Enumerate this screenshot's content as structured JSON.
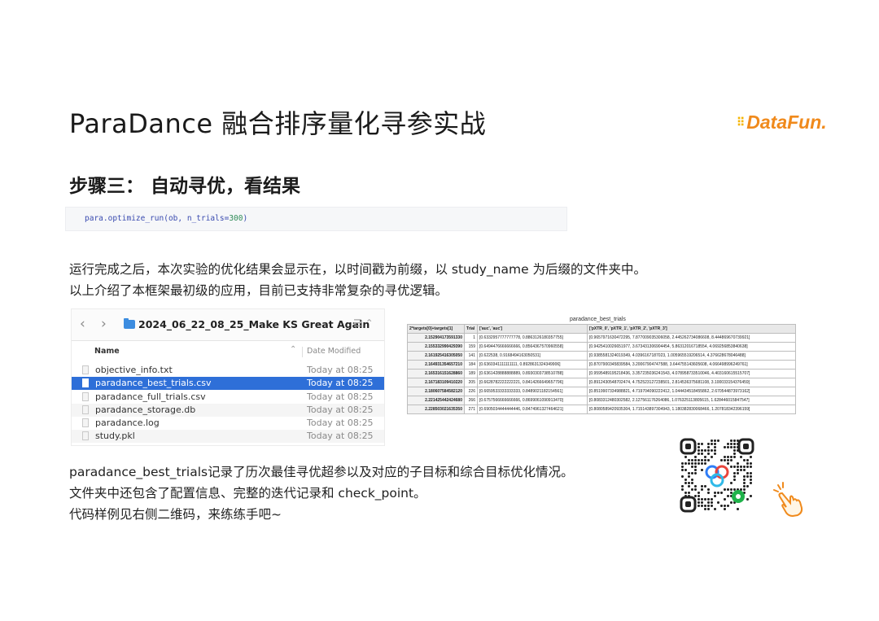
{
  "slide": {
    "title": "ParaDance 融合排序量化寻参实战",
    "step_heading": "步骤三： 自动寻优，看结果"
  },
  "logo": {
    "text_data": "Data",
    "text_fun": "Fun",
    "text_dot": ".",
    "color": "#f08a1c"
  },
  "code": {
    "prefix": "para.optimize_run(ob, n_trials=",
    "number": "300",
    "suffix": ")"
  },
  "intro": [
    "运行完成之后，本次实验的优化结果会显示在，以时间戳为前缀，以 study_name 为后缀的文件夹中。",
    "以上介绍了本框架最初级的应用，目前已支持非常复杂的寻优逻辑。"
  ],
  "finder": {
    "back": "‹",
    "forward": "›",
    "folder_name": "2024_06_22_08_25_Make KS Great Again",
    "view_toggle": "☰ ⌃",
    "col_name": "Name",
    "sort_chevron": "⌃",
    "col_date": "Date Modified",
    "files": [
      {
        "name": "objective_info.txt",
        "date": "Today at 08:25"
      },
      {
        "name": "paradance_best_trials.csv",
        "date": "Today at 08:25",
        "selected": true
      },
      {
        "name": "paradance_full_trials.csv",
        "date": "Today at 08:25"
      },
      {
        "name": "paradance_storage.db",
        "date": "Today at 08:25"
      },
      {
        "name": "paradance.log",
        "date": "Today at 08:25"
      },
      {
        "name": "study.pkl",
        "date": "Today at 08:25"
      }
    ],
    "selected_color": "#2e6fd8"
  },
  "csv": {
    "title": "paradance_best_trials",
    "headers": [
      "2*targets[0]+targets[1]",
      "Trial",
      "['auc', 'auc']",
      "['pXTR_0', 'pXTR_1', 'pXTR_2', 'pXTR_3']"
    ],
    "rows": [
      [
        "2.152904173591330",
        "1",
        "[0.6332957777777778, 0.8863126180357755]",
        "[0.9657971630472295, 7.877009035306058, 2.445262734086608, 8.444869670739921]"
      ],
      [
        "2.155332990429390",
        "159",
        "[0.6494476666666666, 0.8564367570960558]",
        "[0.9425410026651977, 3.673431306904454, 5.86312016718554, 4.069256853840638]"
      ],
      [
        "2.161925416305050",
        "141",
        "[0.622538, 0.9168494163050531]",
        "[0.9385581324019349, 4.0396167187023, 1.005965519206514, 4.376628678046488]"
      ],
      [
        "2.164931354657210",
        "184",
        "[0.6360341111111111, 0.8928631324349906]",
        "[0.8707900345839584, 3.20067904747588, 3.644755143605608, 4.066498996249761]"
      ],
      [
        "2.165316151628860",
        "189",
        "[0.6361428888888889, 0.8930303738510788]",
        "[0.9595489195218436, 3.357235036241543, 4.078958733510046, 4.403160615515707]"
      ],
      [
        "2.167183109410220",
        "205",
        "[0.6628782222222221, 0.8414266649657796]",
        "[0.8912430548702474, 4.752523127238501, 2.814536375681108, 3.100033154376459]"
      ],
      [
        "2.180607584582120",
        "226",
        "[0.6659533333333333, 0.8489021182154561]",
        "[0.8519907334988821, 4.719704090222412, 1.044434518455862, 2.670544873973162]"
      ],
      [
        "2.221425442424680",
        "266",
        "[0.6757566666666666, 0.8699061090913470]",
        "[0.8083312480302582, 2.127561176264086, 1.076325113805615, 1.628446015847547]"
      ],
      [
        "2.228503021635350",
        "271",
        "[0.6905034444444446, 0.8474961327464621]",
        "[0.8080589420935304, 1.715143897304943, 1.180382830068466, 1.207818342396159]"
      ]
    ]
  },
  "summary": [
    "paradance_best_trials记录了历次最佳寻优超参以及对应的子目标和综合目标优化情况。",
    "文件夹中还包含了配置信息、完整的迭代记录和 check_point。",
    "代码样例见右侧二维码，来练练手吧~"
  ],
  "icons": {
    "folder": "folder-icon",
    "file": "file-icon",
    "qr": "qr-code",
    "hand": "pointing-hand-icon"
  }
}
